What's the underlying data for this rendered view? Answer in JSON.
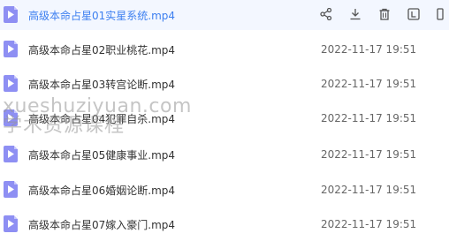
{
  "files": [
    {
      "name": "高级本命占星01实星系统.mp4",
      "date": "",
      "active": true
    },
    {
      "name": "高级本命占星02职业桃花.mp4",
      "date": "2022-11-17 19:51",
      "active": false
    },
    {
      "name": "高级本命占星03转宫论断.mp4",
      "date": "2022-11-17 19:51",
      "active": false
    },
    {
      "name": "高级本命占星04犯罪自杀.mp4",
      "date": "2022-11-17 19:51",
      "active": false
    },
    {
      "name": "高级本命占星05健康事业.mp4",
      "date": "2022-11-17 19:51",
      "active": false
    },
    {
      "name": "高级本命占星06婚姻论断.mp4",
      "date": "2022-11-17 19:51",
      "active": false
    },
    {
      "name": "高级本命占星07嫁入豪门.mp4",
      "date": "2022-11-17 19:51",
      "active": false
    }
  ],
  "row_actions": [
    {
      "icon": "share-icon"
    },
    {
      "icon": "download-icon"
    },
    {
      "icon": "delete-icon"
    },
    {
      "icon": "rename-icon"
    },
    {
      "icon": "more-icon"
    }
  ],
  "watermark": {
    "line1": "xueshuziyuan.com",
    "line2": "学术资源课程"
  },
  "colors": {
    "active_row_bg": "#f3f7ff",
    "active_text": "#3d7ff0",
    "video_icon": "#8e8ff3"
  }
}
